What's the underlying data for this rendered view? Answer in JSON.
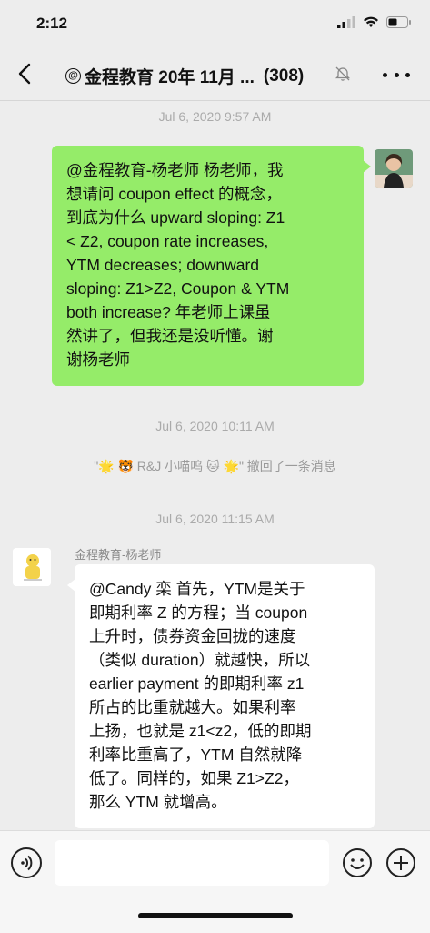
{
  "status": {
    "time": "2:12"
  },
  "nav": {
    "mention_symbol": "@",
    "title": "金程教育 20年 11月 ...",
    "count": "(308)"
  },
  "messages": {
    "ts1": "Jul 6, 2020 9:57 AM",
    "m1_text": "@金程教育-杨老师 杨老师，我\n想请问 coupon effect 的概念，\n到底为什么 upward sloping: Z1\n< Z2, coupon rate increases,\nYTM decreases; downward\nsloping: Z1>Z2, Coupon & YTM\n both increase? 年老师上课虽\n然讲了，但我还是没听懂。谢\n谢杨老师",
    "ts2": "Jul 6, 2020 10:11 AM",
    "recall": "\"🌟 🐯 R&J 小喵呜 🐱 🌟\" 撤回了一条消息",
    "ts3": "Jul 6, 2020 11:15 AM",
    "m2_sender": "金程教育-杨老师",
    "m2_text": "@Candy 栾 首先，YTM是关于\n即期利率 Z 的方程；当 coupon\n上升时，债券资金回拢的速度\n（类似 duration）就越快，所以\nearlier payment 的即期利率 z1\n所占的比重就越大。如果利率\n上扬，也就是 z1<z2，低的即期\n利率比重高了，YTM 自然就降\n低了。同样的，如果 Z1>Z2，\n那么 YTM 就增高。"
  },
  "input": {
    "placeholder": ""
  },
  "colors": {
    "green_bubble": "#95ec69",
    "background": "#ededed"
  },
  "icons": [
    "signal-icon",
    "wifi-icon",
    "battery-icon",
    "back-icon",
    "mute-icon",
    "more-icon",
    "voice-icon",
    "emoji-icon",
    "plus-icon"
  ]
}
